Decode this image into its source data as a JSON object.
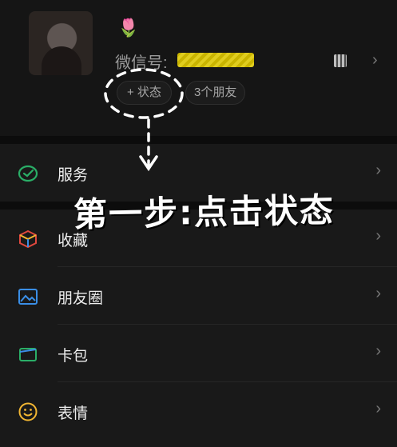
{
  "profile": {
    "flower_emoji": "🌷",
    "wechat_id_label": "微信号:",
    "wechat_id_value": "redacted",
    "status_button": "+ 状态",
    "friends_button": "3个朋友"
  },
  "menu": [
    {
      "label": "服务",
      "icon": "wechat-pay-icon"
    },
    {
      "label": "收藏",
      "icon": "favorites-cube-icon"
    },
    {
      "label": "朋友圈",
      "icon": "moments-image-icon"
    },
    {
      "label": "卡包",
      "icon": "card-wallet-icon"
    },
    {
      "label": "表情",
      "icon": "sticker-smile-icon"
    }
  ],
  "annotation": {
    "text": "第一步:点击状态"
  },
  "colors": {
    "background": "#121212",
    "row": "#191919",
    "wechat_green": "#2aae67",
    "highlight_yellow": "#e0cd1e"
  }
}
